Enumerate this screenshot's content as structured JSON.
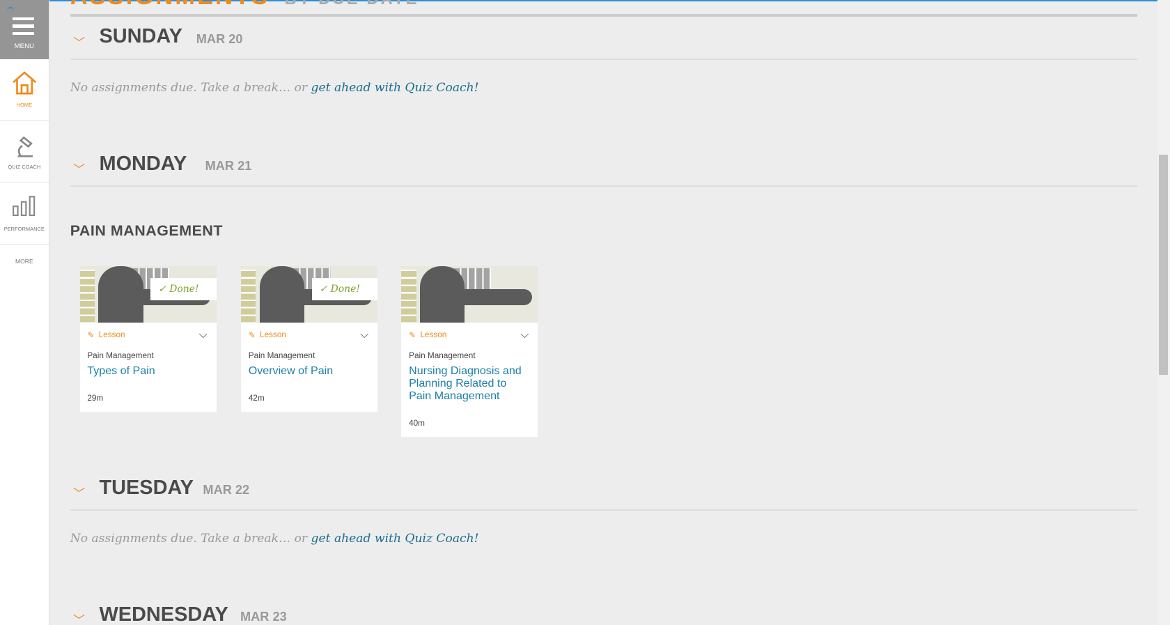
{
  "sidebar": {
    "menu": "MENU",
    "items": [
      {
        "label": "HOME",
        "icon": "home-icon"
      },
      {
        "label": "QUIZ COACH",
        "icon": "microscope-icon"
      },
      {
        "label": "PERFORMANCE",
        "icon": "bar-chart-icon"
      }
    ],
    "more": "MORE"
  },
  "header": {
    "title": "ASSIGNMENTS",
    "subtitle": "BY DUE DATE"
  },
  "empty": {
    "text": "No assignments due. Take a break… or ",
    "link": "get ahead with Quiz Coach!"
  },
  "days": [
    {
      "name": "SUNDAY",
      "date": "MAR 20"
    },
    {
      "name": "MONDAY",
      "date": "MAR 21"
    },
    {
      "name": "TUESDAY",
      "date": "MAR 22"
    },
    {
      "name": "WEDNESDAY",
      "date": "MAR 23"
    }
  ],
  "section": "PAIN MANAGEMENT",
  "cards": [
    {
      "type": "Lesson",
      "topic": "Pain Management",
      "title": "Types of Pain",
      "duration": "29m",
      "status": "Done!"
    },
    {
      "type": "Lesson",
      "topic": "Pain Management",
      "title": "Overview of Pain",
      "duration": "42m",
      "status": "Done!"
    },
    {
      "type": "Lesson",
      "topic": "Pain Management",
      "title": "Nursing Diagnosis and Planning Related to Pain Management",
      "duration": "40m"
    }
  ],
  "colors": {
    "accent": "#f08a1c",
    "link": "#1a7fa8",
    "done": "#7fa12a"
  }
}
